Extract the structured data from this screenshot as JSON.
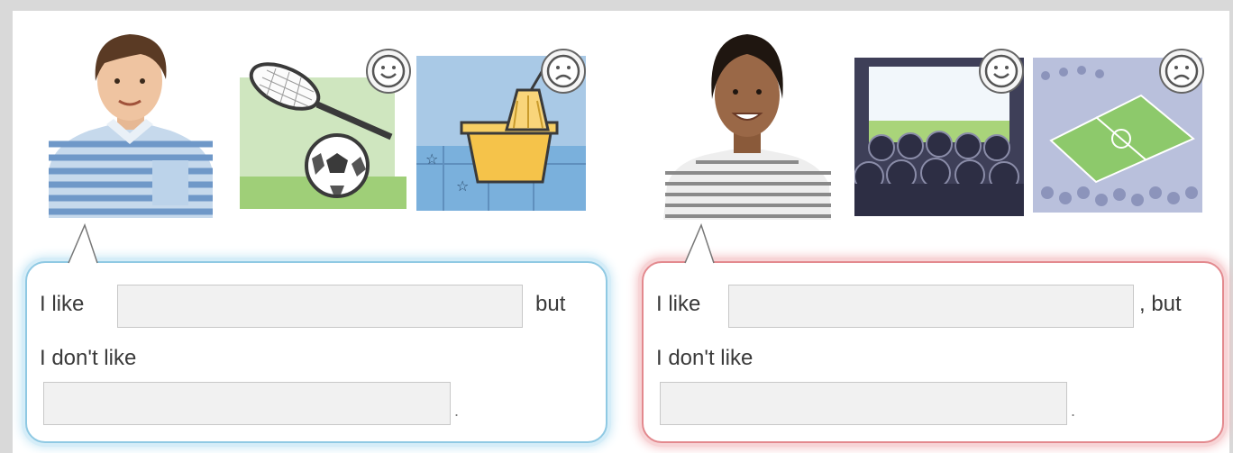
{
  "left_panel": {
    "line1_prefix": "I like",
    "line1_suffix": "but",
    "line2": "I don't like",
    "line3_suffix": ".",
    "input1_value": "",
    "input2_value": "",
    "accent": "#8fc9e3",
    "boy_icons": [
      "happy-face",
      "sad-face"
    ]
  },
  "right_panel": {
    "line1_prefix": "I like",
    "line1_suffix": ", but",
    "line2": "I don't like",
    "line3_suffix": ".",
    "input1_value": "",
    "input2_value": "",
    "accent": "#e3898e",
    "girl_icons": [
      "happy-face",
      "sad-face"
    ]
  }
}
